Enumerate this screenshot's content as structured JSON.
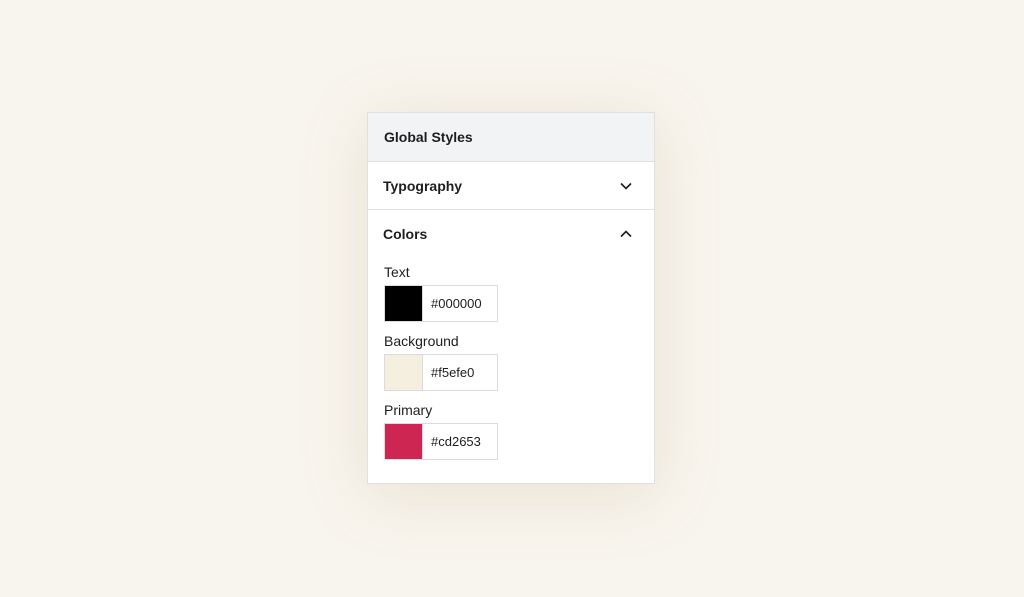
{
  "panel": {
    "title": "Global Styles",
    "sections": {
      "typography": {
        "label": "Typography",
        "expanded": false,
        "icon": "chevron-down-icon"
      },
      "colors": {
        "label": "Colors",
        "expanded": true,
        "icon": "chevron-up-icon",
        "items": [
          {
            "label": "Text",
            "value": "#000000"
          },
          {
            "label": "Background",
            "value": "#f5efe0"
          },
          {
            "label": "Primary",
            "value": "#cd2653"
          }
        ]
      }
    }
  }
}
